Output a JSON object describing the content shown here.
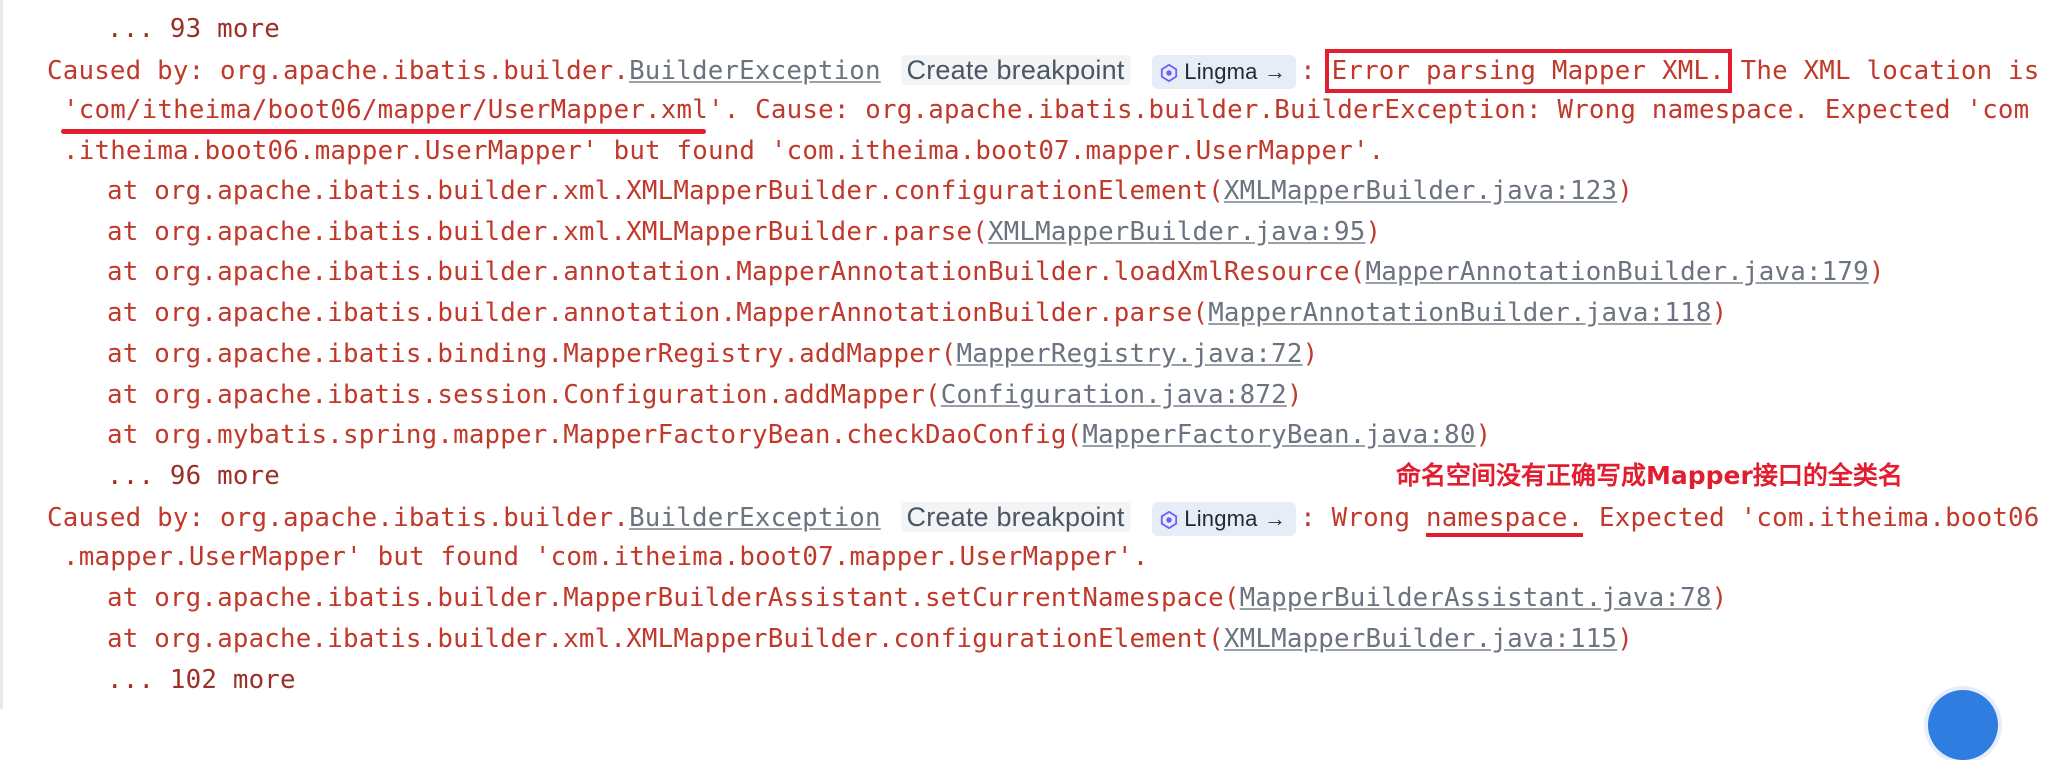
{
  "console": {
    "lines": [
      {
        "kind": "more",
        "text": "... 93 more"
      },
      {
        "kind": "caused",
        "prefix": "Caused by: org.apache.ibatis.builder.",
        "link": "BuilderException",
        "breakpoint": "Create breakpoint",
        "lingma": "Lingma",
        "lingma_arrow": "→",
        "sep": ":",
        "highlight": "Error parsing Mapper XML.",
        "rest": " The XML location is"
      },
      {
        "kind": "cont",
        "highlight": "'com/itheima/boot06/mapper/UserMapper.xml'",
        "rest": ". Cause: org.apache.ibatis.builder.BuilderException: Wrong namespace. Expected 'com"
      },
      {
        "kind": "cont",
        "text": ".itheima.boot06.mapper.UserMapper' but found 'com.itheima.boot07.mapper.UserMapper'."
      },
      {
        "kind": "at",
        "text": "at org.apache.ibatis.builder.xml.XMLMapperBuilder.configurationElement(",
        "link": "XMLMapperBuilder.java:123",
        "close": ")"
      },
      {
        "kind": "at",
        "text": "at org.apache.ibatis.builder.xml.XMLMapperBuilder.parse(",
        "link": "XMLMapperBuilder.java:95",
        "close": ")"
      },
      {
        "kind": "at",
        "text": "at org.apache.ibatis.builder.annotation.MapperAnnotationBuilder.loadXmlResource(",
        "link": "MapperAnnotationBuilder.java:179",
        "close": ")"
      },
      {
        "kind": "at",
        "text": "at org.apache.ibatis.builder.annotation.MapperAnnotationBuilder.parse(",
        "link": "MapperAnnotationBuilder.java:118",
        "close": ")"
      },
      {
        "kind": "at",
        "text": "at org.apache.ibatis.binding.MapperRegistry.addMapper(",
        "link": "MapperRegistry.java:72",
        "close": ")"
      },
      {
        "kind": "at",
        "text": "at org.apache.ibatis.session.Configuration.addMapper(",
        "link": "Configuration.java:872",
        "close": ")"
      },
      {
        "kind": "at",
        "text": "at org.mybatis.spring.mapper.MapperFactoryBean.checkDaoConfig(",
        "link": "MapperFactoryBean.java:80",
        "close": ")"
      },
      {
        "kind": "more",
        "text": "... 96 more"
      },
      {
        "kind": "caused2",
        "prefix": "Caused by: org.apache.ibatis.builder.",
        "link": "BuilderException",
        "breakpoint": "Create breakpoint",
        "lingma": "Lingma",
        "lingma_arrow": "→",
        "sep": ": Wrong ",
        "highlight": "namespace.",
        "rest": " Expected 'com.itheima.boot06"
      },
      {
        "kind": "cont",
        "text": ".mapper.UserMapper' but found 'com.itheima.boot07.mapper.UserMapper'."
      },
      {
        "kind": "at",
        "text": "at org.apache.ibatis.builder.MapperBuilderAssistant.setCurrentNamespace(",
        "link": "MapperBuilderAssistant.java:78",
        "close": ")"
      },
      {
        "kind": "at",
        "text": "at org.apache.ibatis.builder.xml.XMLMapperBuilder.configurationElement(",
        "link": "XMLMapperBuilder.java:115",
        "close": ")"
      },
      {
        "kind": "more",
        "text": "... 102 more"
      }
    ]
  },
  "annotation": {
    "text": "命名空间没有正确写成Mapper接口的全类名"
  },
  "colors": {
    "error_text": "#c0392b",
    "annotation_red": "#e11d2f",
    "link_gray": "#6b7280"
  }
}
